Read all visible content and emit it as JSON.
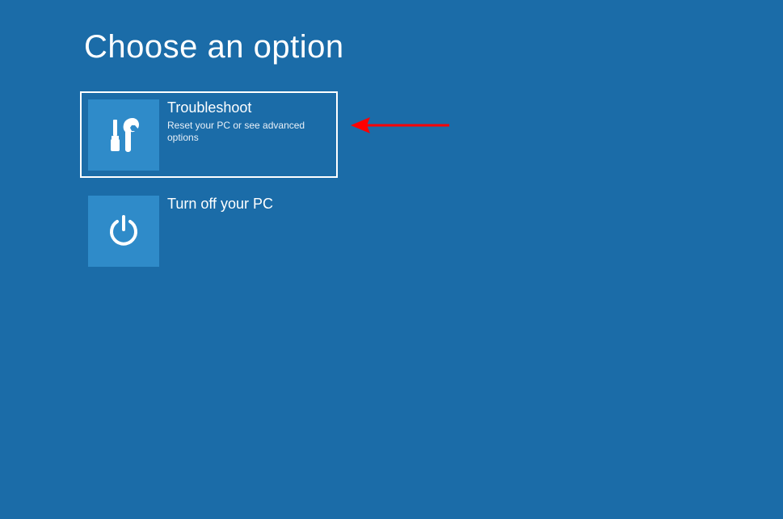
{
  "header": {
    "title": "Choose an option"
  },
  "options": [
    {
      "title": "Troubleshoot",
      "description": "Reset your PC or see advanced options",
      "icon": "tools-icon",
      "selected": true
    },
    {
      "title": "Turn off your PC",
      "description": "",
      "icon": "power-icon",
      "selected": false
    }
  ],
  "annotation": {
    "type": "arrow",
    "color": "#ff0000"
  }
}
